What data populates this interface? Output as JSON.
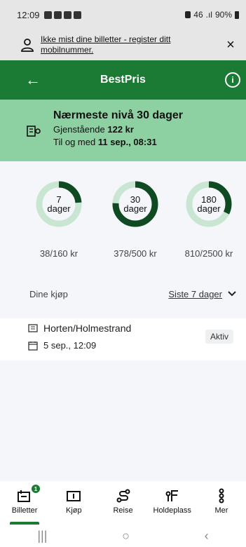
{
  "status_bar": {
    "time": "12:09",
    "signal": "46",
    "battery": "90%"
  },
  "banner": {
    "text": "Ikke mist dine billetter - register ditt mobilnummer.",
    "close": "×"
  },
  "header": {
    "back": "←",
    "title": "BestPris",
    "info": "i"
  },
  "summary": {
    "heading": "Nærmeste nivå 30 dager",
    "remaining_label": "Gjenstående",
    "remaining_value": "122 kr",
    "until_label": "Til og med",
    "until_value": "11 sep., 08:31"
  },
  "levels": [
    {
      "num": "7",
      "unit": "dager",
      "amount": "38/160 kr",
      "progress": 0.2375
    },
    {
      "num": "30",
      "unit": "dager",
      "amount": "378/500 kr",
      "progress": 0.756
    },
    {
      "num": "180",
      "unit": "dager",
      "amount": "810/2500 kr",
      "progress": 0.324
    }
  ],
  "purchases": {
    "label": "Dine kjøp",
    "filter": "Siste 7 dager"
  },
  "ticket": {
    "route": "Horten/Holmestrand",
    "date": "5 sep., 12:09",
    "status": "Aktiv"
  },
  "bottom_nav": {
    "items": [
      {
        "label": "Billetter",
        "badge": "1"
      },
      {
        "label": "Kjøp"
      },
      {
        "label": "Reise"
      },
      {
        "label": "Holdeplass"
      },
      {
        "label": "Mer"
      }
    ]
  },
  "system_nav": {
    "recents": "|||",
    "home": "○",
    "back": "‹"
  },
  "colors": {
    "primary": "#1b7a34",
    "summary_bg": "#8dd0a2",
    "ring_track": "#c9e6d3",
    "ring_fill": "#0f4a22"
  }
}
